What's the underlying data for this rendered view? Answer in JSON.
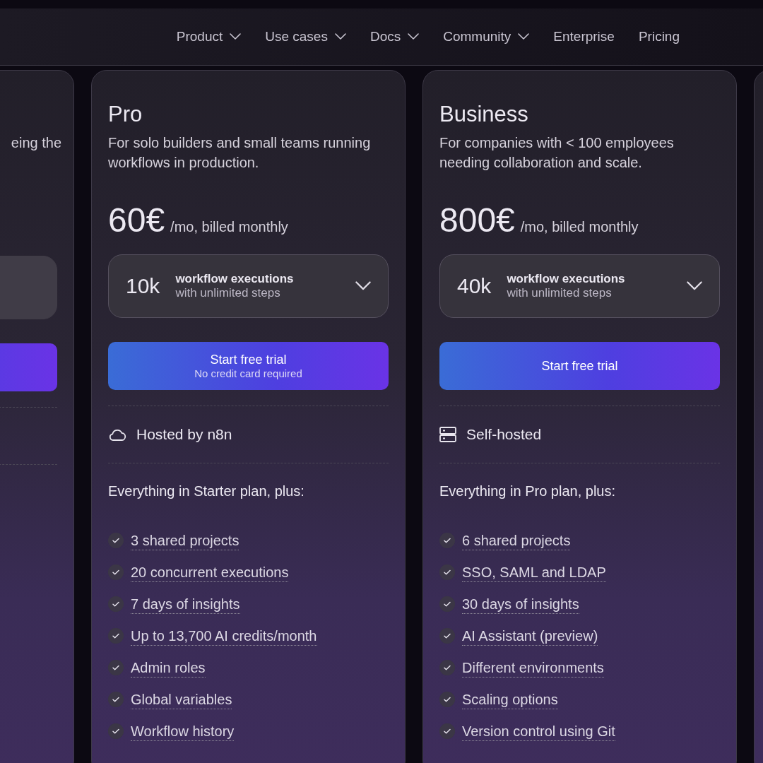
{
  "nav": {
    "items": [
      {
        "label": "Product",
        "dropdown": true
      },
      {
        "label": "Use cases",
        "dropdown": true
      },
      {
        "label": "Docs",
        "dropdown": true
      },
      {
        "label": "Community",
        "dropdown": true
      },
      {
        "label": "Enterprise",
        "dropdown": false
      },
      {
        "label": "Pricing",
        "dropdown": false
      }
    ]
  },
  "partial_plan": {
    "description": "eing the"
  },
  "plans": [
    {
      "name": "Pro",
      "description": "For solo builders and small teams running workflows in production.",
      "price": "60€",
      "price_suffix": "/mo, billed monthly",
      "selector": {
        "amount": "10k",
        "title": "workflow executions",
        "subtitle": "with unlimited steps"
      },
      "button": {
        "label": "Start free trial",
        "sublabel": "No credit card required"
      },
      "hosting": {
        "kind": "cloud",
        "label": "Hosted by n8n"
      },
      "features_intro": "Everything in Starter plan, plus:",
      "features": [
        "3 shared projects",
        "20 concurrent executions",
        "7 days of insights",
        "Up to 13,700 AI credits/month",
        "Admin roles",
        "Global variables",
        "Workflow history"
      ]
    },
    {
      "name": "Business",
      "description": "For companies with < 100 employees needing collaboration and scale.",
      "price": "800€",
      "price_suffix": "/mo, billed monthly",
      "selector": {
        "amount": "40k",
        "title": "workflow executions",
        "subtitle": "with unlimited steps"
      },
      "button": {
        "label": "Start free trial"
      },
      "hosting": {
        "kind": "server",
        "label": "Self-hosted"
      },
      "features_intro": "Everything in Pro plan, plus:",
      "features": [
        "6 shared projects",
        "SSO, SAML and LDAP",
        "30 days of insights",
        "AI Assistant (preview)",
        "Different environments",
        "Scaling options",
        "Version control using Git"
      ]
    }
  ]
}
